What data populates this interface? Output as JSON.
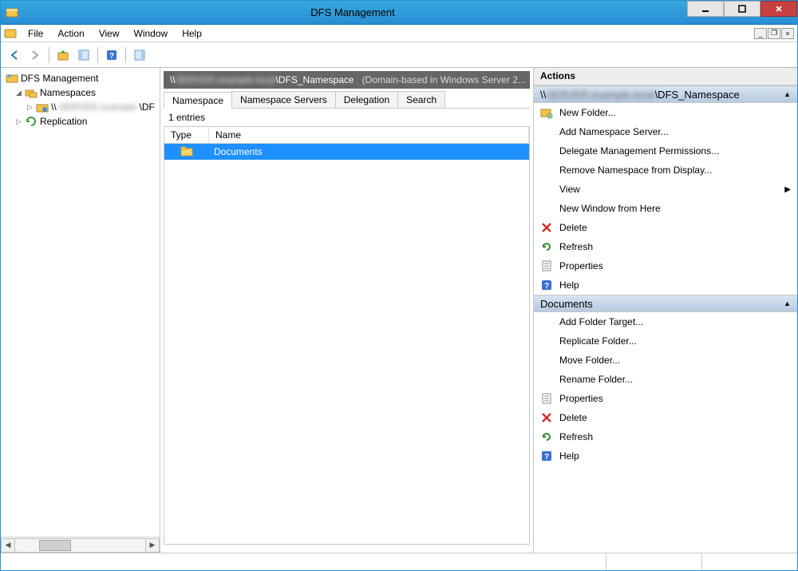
{
  "window": {
    "title": "DFS Management"
  },
  "menubar": {
    "file": "File",
    "action": "Action",
    "view": "View",
    "window": "Window",
    "help": "Help"
  },
  "tree": {
    "root": "DFS Management",
    "namespaces": "Namespaces",
    "namespace_item_prefix": "\\\\",
    "namespace_item_suffix": "\\DF",
    "replication": "Replication"
  },
  "center": {
    "path_prefix": "\\\\",
    "path_redacted": "SERVER.example.local",
    "path_suffix": "\\DFS_Namespace",
    "path_note": "(Domain-based in Windows Server 2...",
    "tabs": {
      "namespace": "Namespace",
      "servers": "Namespace Servers",
      "delegation": "Delegation",
      "search": "Search"
    },
    "entries_label": "1 entries",
    "columns": {
      "type": "Type",
      "name": "Name"
    },
    "rows": [
      {
        "name": "Documents"
      }
    ]
  },
  "actions": {
    "header": "Actions",
    "section1_prefix": "\\\\",
    "section1_redacted": "SERVER.example.local",
    "section1_suffix": "\\DFS_Namespace",
    "s1": {
      "new_folder": "New Folder...",
      "add_server": "Add Namespace Server...",
      "delegate": "Delegate Management Permissions...",
      "remove": "Remove Namespace from Display...",
      "view": "View",
      "new_window": "New Window from Here",
      "delete": "Delete",
      "refresh": "Refresh",
      "properties": "Properties",
      "help": "Help"
    },
    "section2_title": "Documents",
    "s2": {
      "add_target": "Add Folder Target...",
      "replicate": "Replicate Folder...",
      "move": "Move Folder...",
      "rename": "Rename Folder...",
      "properties": "Properties",
      "delete": "Delete",
      "refresh": "Refresh",
      "help": "Help"
    }
  }
}
